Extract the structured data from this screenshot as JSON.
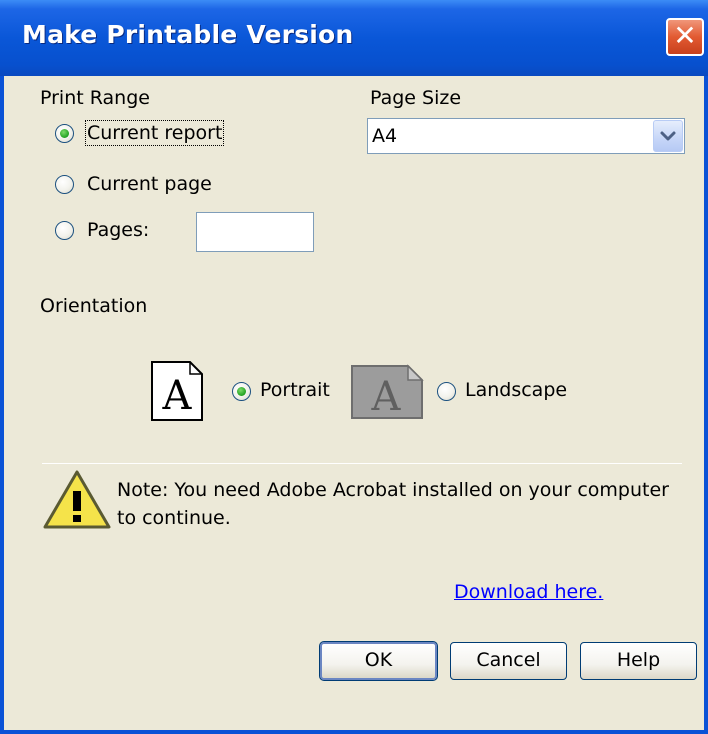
{
  "dialog": {
    "title": "Make Printable Version",
    "close_glyph": "✕"
  },
  "print_range": {
    "label": "Print Range",
    "options": [
      {
        "label": "Current report",
        "selected": true
      },
      {
        "label": "Current page",
        "selected": false
      },
      {
        "label": "Pages:",
        "selected": false
      }
    ],
    "pages_value": ""
  },
  "page_size": {
    "label": "Page Size",
    "selected": "A4"
  },
  "orientation": {
    "label": "Orientation",
    "options": [
      {
        "label": "Portrait",
        "selected": true,
        "icon": "portrait-page-icon",
        "glyph": "A"
      },
      {
        "label": "Landscape",
        "selected": false,
        "icon": "landscape-page-icon",
        "glyph": "A"
      }
    ]
  },
  "note": {
    "icon": "warning-icon",
    "line1": "Note: You need Adobe Acrobat installed on your computer",
    "line2": "to continue."
  },
  "download_link": "Download here.",
  "buttons": {
    "ok": "OK",
    "cancel": "Cancel",
    "help": "Help"
  },
  "colors": {
    "titlebar": "#0A57D8",
    "dialog_bg": "#ECE9D8",
    "link": "#0000FF",
    "radio_selected": "#21A121",
    "close_button": "#E25A32"
  }
}
